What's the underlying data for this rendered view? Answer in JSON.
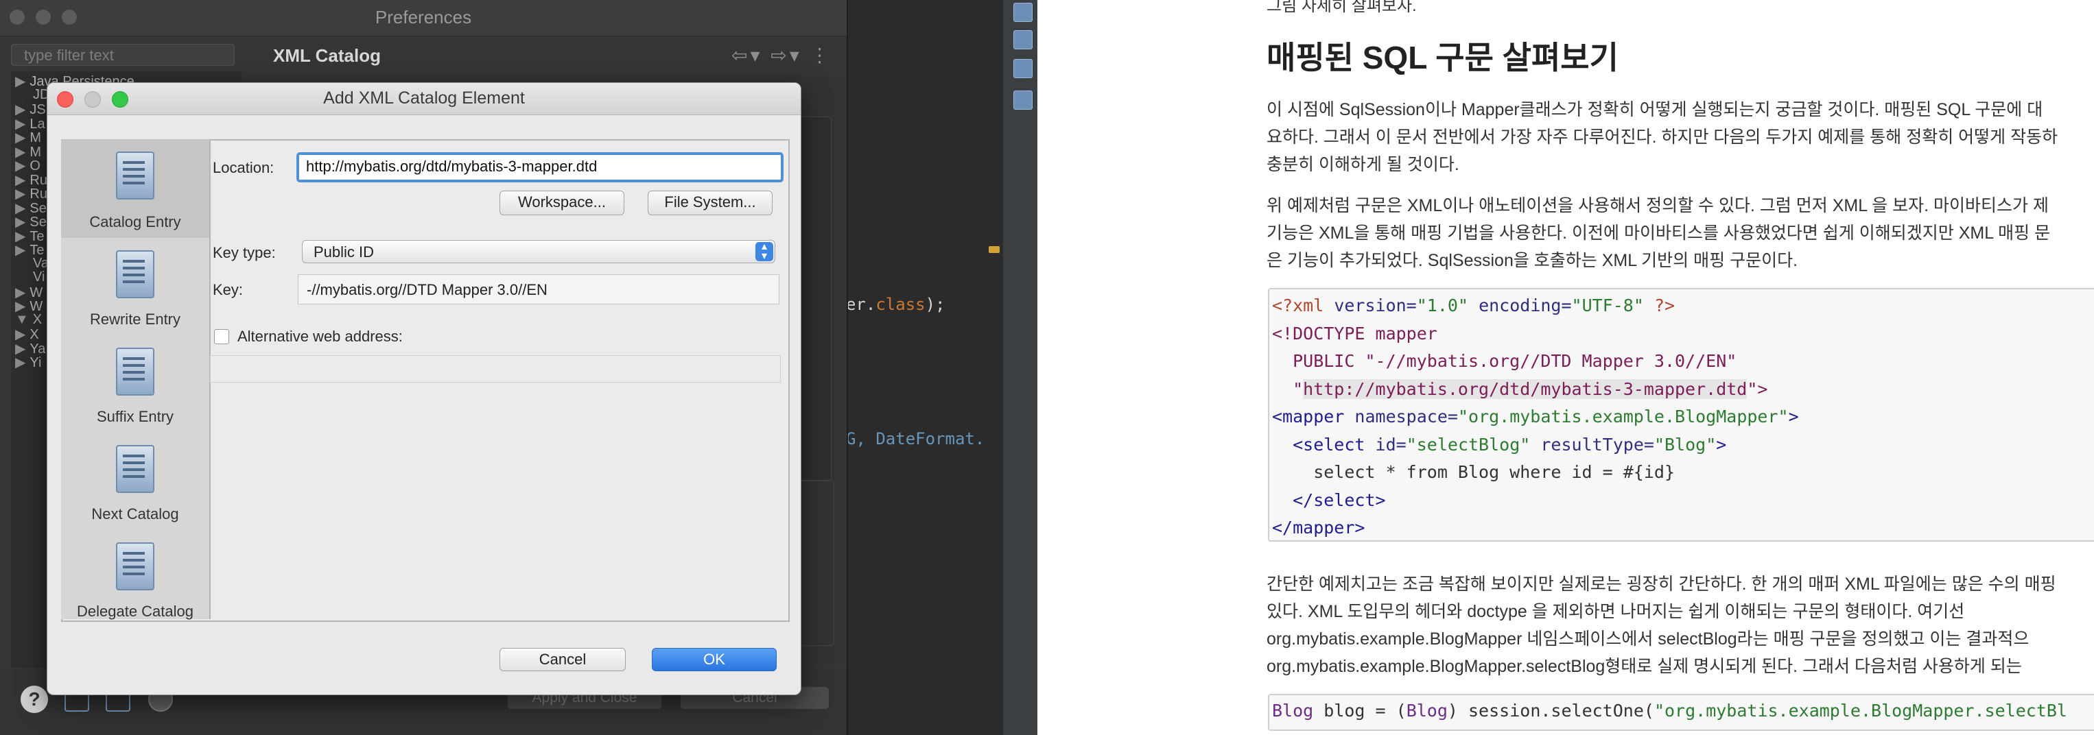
{
  "preferences": {
    "window_title": "Preferences",
    "filter_placeholder": "type filter text",
    "section_title": "XML Catalog",
    "nav_arrows": "⇦▾ ⇨▾ ⋮",
    "tree_items": [
      {
        "label": "Java Persistence",
        "arrow": "▶"
      },
      {
        "label": "JD",
        "arrow": ""
      },
      {
        "label": "JS",
        "arrow": "▶"
      },
      {
        "label": "La",
        "arrow": "▶"
      },
      {
        "label": "M",
        "arrow": "▶"
      },
      {
        "label": "M",
        "arrow": "▶"
      },
      {
        "label": "O",
        "arrow": "▶"
      },
      {
        "label": "Ru",
        "arrow": "▶"
      },
      {
        "label": "Ru",
        "arrow": "▶"
      },
      {
        "label": "Se",
        "arrow": "▶"
      },
      {
        "label": "Se",
        "arrow": "▶"
      },
      {
        "label": "Te",
        "arrow": "▶"
      },
      {
        "label": "Te",
        "arrow": "▶"
      },
      {
        "label": "Va",
        "arrow": ""
      },
      {
        "label": "Vi",
        "arrow": ""
      },
      {
        "label": "W",
        "arrow": "▶"
      },
      {
        "label": "W",
        "arrow": "▶"
      },
      {
        "label": "X",
        "arrow": "▼"
      },
      {
        "label": "X",
        "arrow": "▶"
      },
      {
        "label": "Ya",
        "arrow": "▶"
      },
      {
        "label": "Yi",
        "arrow": "▶"
      }
    ],
    "apply_close_label": "Apply and Close",
    "cancel_label": "Cancel"
  },
  "editor": {
    "line1_class_ref": "er.",
    "line1_kw": "class",
    "line1_end": ");",
    "line2": "G, DateFormat."
  },
  "dialog": {
    "title": "Add XML Catalog Element",
    "entries": [
      {
        "label": "Catalog Entry"
      },
      {
        "label": "Rewrite Entry"
      },
      {
        "label": "Suffix Entry"
      },
      {
        "label": "Next Catalog"
      },
      {
        "label": "Delegate Catalog"
      }
    ],
    "location_label": "Location:",
    "location_value": "http://mybatis.org/dtd/mybatis-3-mapper.dtd",
    "workspace_button": "Workspace...",
    "filesystem_button": "File System...",
    "keytype_label": "Key type:",
    "keytype_value": "Public ID",
    "key_label": "Key:",
    "key_value": "-//mybatis.org//DTD Mapper 3.0//EN",
    "alt_web_label": "Alternative web address:",
    "cancel_button": "Cancel",
    "ok_button": "OK"
  },
  "doc": {
    "top_fragment": "그림 자세히 살펴보자.",
    "heading": "매핑된 SQL 구문 살펴보기",
    "para1": [
      "이 시점에 SqlSession이나 Mapper클래스가 정확히 어떻게 실행되는지 궁금할 것이다. 매핑된 SQL 구문에 대",
      "요하다. 그래서 이 문서 전반에서 가장 자주 다루어진다. 하지만 다음의 두가지 예제를 통해 정확히 어떻게 작동하",
      "충분히 이해하게 될 것이다."
    ],
    "para2": [
      "위 예제처럼 구문은 XML이나 애노테이션을 사용해서 정의할 수 있다. 그럼 먼저 XML 을 보자. 마이바티스가 제",
      "기능은 XML을 통해 매핑 기법을 사용한다. 이전에 마이바티스를 사용했었다면 쉽게 이해되겠지만 XML 매핑 문",
      "은 기능이 추가되었다. SqlSession을 호출하는 XML 기반의 매핑 구문이다."
    ],
    "code": {
      "l1_pi": "<?xml",
      "l1_a1": "version=",
      "l1_v1": "\"1.0\"",
      "l1_a2": "encoding=",
      "l1_v2": "\"UTF-8\"",
      "l1_end": "?>",
      "l2": "<!DOCTYPE mapper",
      "l3": "  PUBLIC \"-//mybatis.org//DTD Mapper 3.0//EN\"",
      "l4_pre": "  \"",
      "l4_url": "http://mybatis.org/dtd/mybatis-3-mapper.dtd",
      "l4_post": "\">",
      "l5_tag": "<mapper",
      "l5_attr": "namespace=",
      "l5_val": "\"org.mybatis.example.BlogMapper\"",
      "l5_end": ">",
      "l6_tag": "  <select",
      "l6_a1": "id=",
      "l6_v1": "\"selectBlog\"",
      "l6_a2": "resultType=",
      "l6_v2": "\"Blog\"",
      "l6_end": ">",
      "l7": "    select * from Blog where id = #{id}",
      "l8": "  </select>",
      "l9": "</mapper>"
    },
    "para3": [
      "간단한 예제치고는 조금 복잡해 보이지만 실제로는 굉장히 간단하다. 한 개의 매퍼 XML 파일에는 많은 수의 매핑",
      "있다. XML 도입무의 헤더와 doctype 을 제외하면 나머지는 쉽게 이해되는 구문의 형태이다. 여기선",
      "org.mybatis.example.BlogMapper 네임스페이스에서 selectBlog라는 매핑 구문을 정의했고 이는 결과적으",
      "org.mybatis.example.BlogMapper.selectBlog형태로 실제 명시되게 된다. 그래서 다음처럼 사용하게 되는"
    ],
    "code2": {
      "t1": "Blog",
      "t2": " blog = (",
      "t3": "Blog",
      "t4": ") session.selectOne(",
      "t5": "\"org.mybatis.example.BlogMapper.selectBl"
    }
  }
}
